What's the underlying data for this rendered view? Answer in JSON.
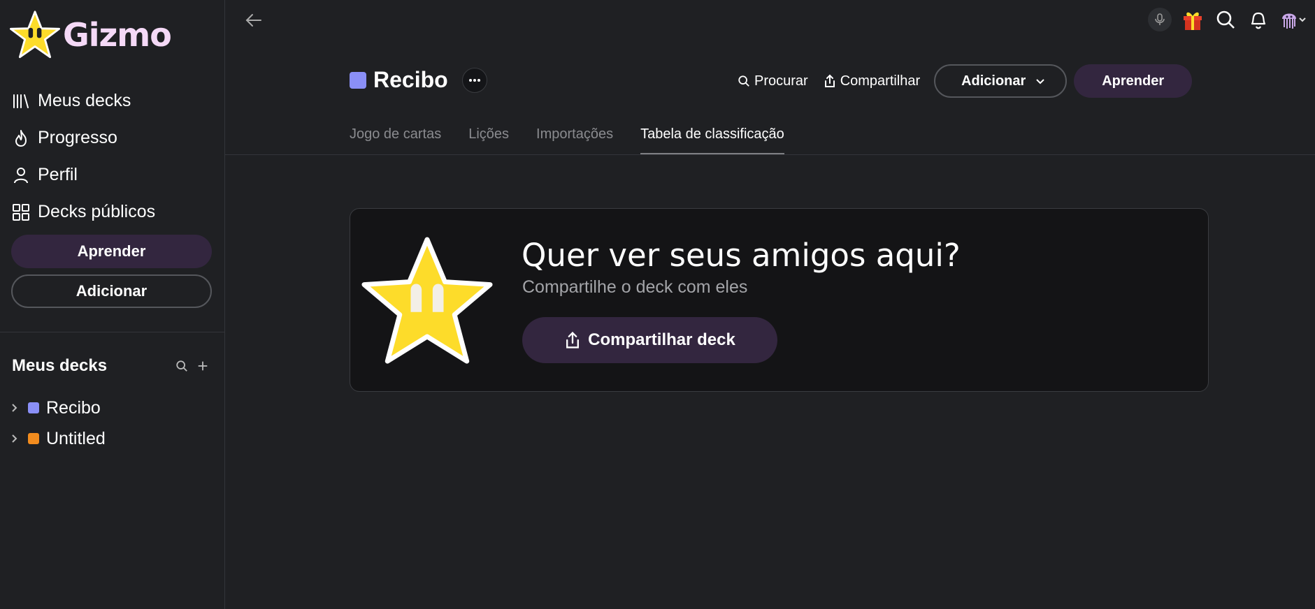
{
  "app": {
    "name": "Gizmo"
  },
  "sidebar": {
    "nav": [
      {
        "label": "Meus decks",
        "icon": "library-icon"
      },
      {
        "label": "Progresso",
        "icon": "flame-icon"
      },
      {
        "label": "Perfil",
        "icon": "user-icon"
      },
      {
        "label": "Decks públicos",
        "icon": "grid-icon"
      }
    ],
    "learn_label": "Aprender",
    "add_label": "Adicionar",
    "decks_title": "Meus decks",
    "decks": [
      {
        "name": "Recibo",
        "color": "#8a8ff7"
      },
      {
        "name": "Untitled",
        "color": "#f28c1e"
      }
    ]
  },
  "deck": {
    "title": "Recibo",
    "color": "#8a8ff7",
    "search_label": "Procurar",
    "share_label": "Compartilhar",
    "add_label": "Adicionar",
    "learn_label": "Aprender"
  },
  "tabs": [
    {
      "label": "Jogo de cartas",
      "active": false
    },
    {
      "label": "Lições",
      "active": false
    },
    {
      "label": "Importações",
      "active": false
    },
    {
      "label": "Tabela de classificação",
      "active": true
    }
  ],
  "leaderboard_empty": {
    "title": "Quer ver seus amigos aqui?",
    "subtitle": "Compartilhe o deck com eles",
    "button_label": "Compartilhar deck"
  },
  "colors": {
    "accent": "#33263f",
    "logo_text": "#f5d9f7",
    "star": "#fddc2a"
  }
}
